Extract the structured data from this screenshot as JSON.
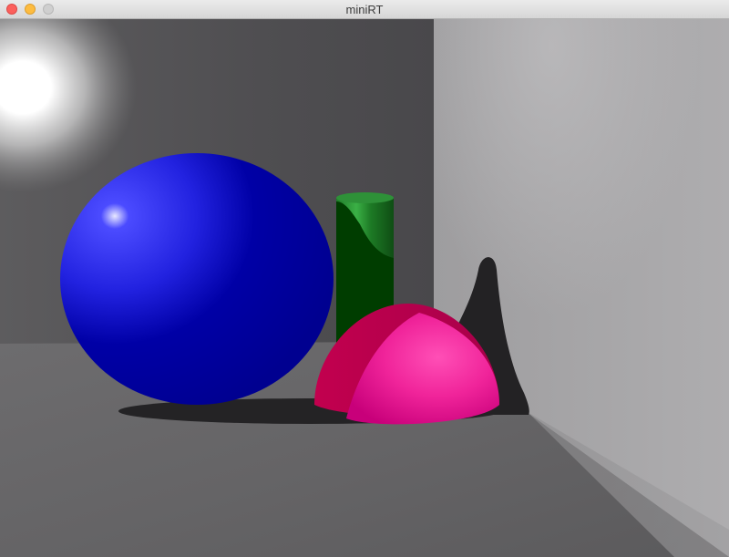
{
  "window": {
    "title": "miniRT",
    "controls": [
      "close-icon",
      "minimize-icon",
      "zoom-icon"
    ]
  },
  "colors": {
    "close": "#fc605c",
    "minimize": "#fdbc40",
    "zoom": "#cfcfcf",
    "sphere": "#0000a6",
    "cylinder": "#004400",
    "hemisphere": "#c8005a",
    "floor": "#6a696b",
    "back_wall": "#4e4d50",
    "right_wall": "#a7a6a8"
  },
  "scene": {
    "objects": [
      "light",
      "back-wall",
      "right-wall",
      "floor",
      "sphere",
      "cylinder",
      "hemisphere"
    ]
  }
}
